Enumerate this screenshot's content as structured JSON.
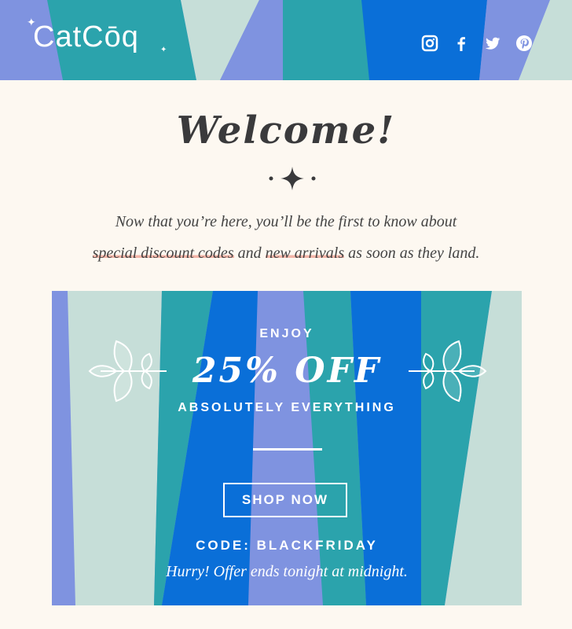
{
  "brand": {
    "logo_text": "CatCōq"
  },
  "social": [
    {
      "name": "instagram-icon"
    },
    {
      "name": "facebook-icon"
    },
    {
      "name": "twitter-icon"
    },
    {
      "name": "pinterest-icon"
    }
  ],
  "welcome": {
    "title": "Welcome!",
    "line1": "Now that you’re here, you’ll be the first to know about",
    "highlight1": "special discount codes",
    "and_text": " and ",
    "highlight2": "new arrivals",
    "tail": " as soon as they land."
  },
  "promo": {
    "enjoy": "ENJOY",
    "discount": "25% OFF",
    "scope": "ABSOLUTELY EVERYTHING",
    "cta": "SHOP NOW",
    "code": "CODE: BLACKFRIDAY",
    "note": "Hurry! Offer ends tonight at midnight."
  },
  "colors": {
    "periwinkle": "#7f93e0",
    "teal": "#2ba3ac",
    "mint": "#c6ded8",
    "royal": "#0a6fd8",
    "cream": "#fdf8f1",
    "text": "#3a3a3c",
    "highlight": "#f3b5a8"
  }
}
